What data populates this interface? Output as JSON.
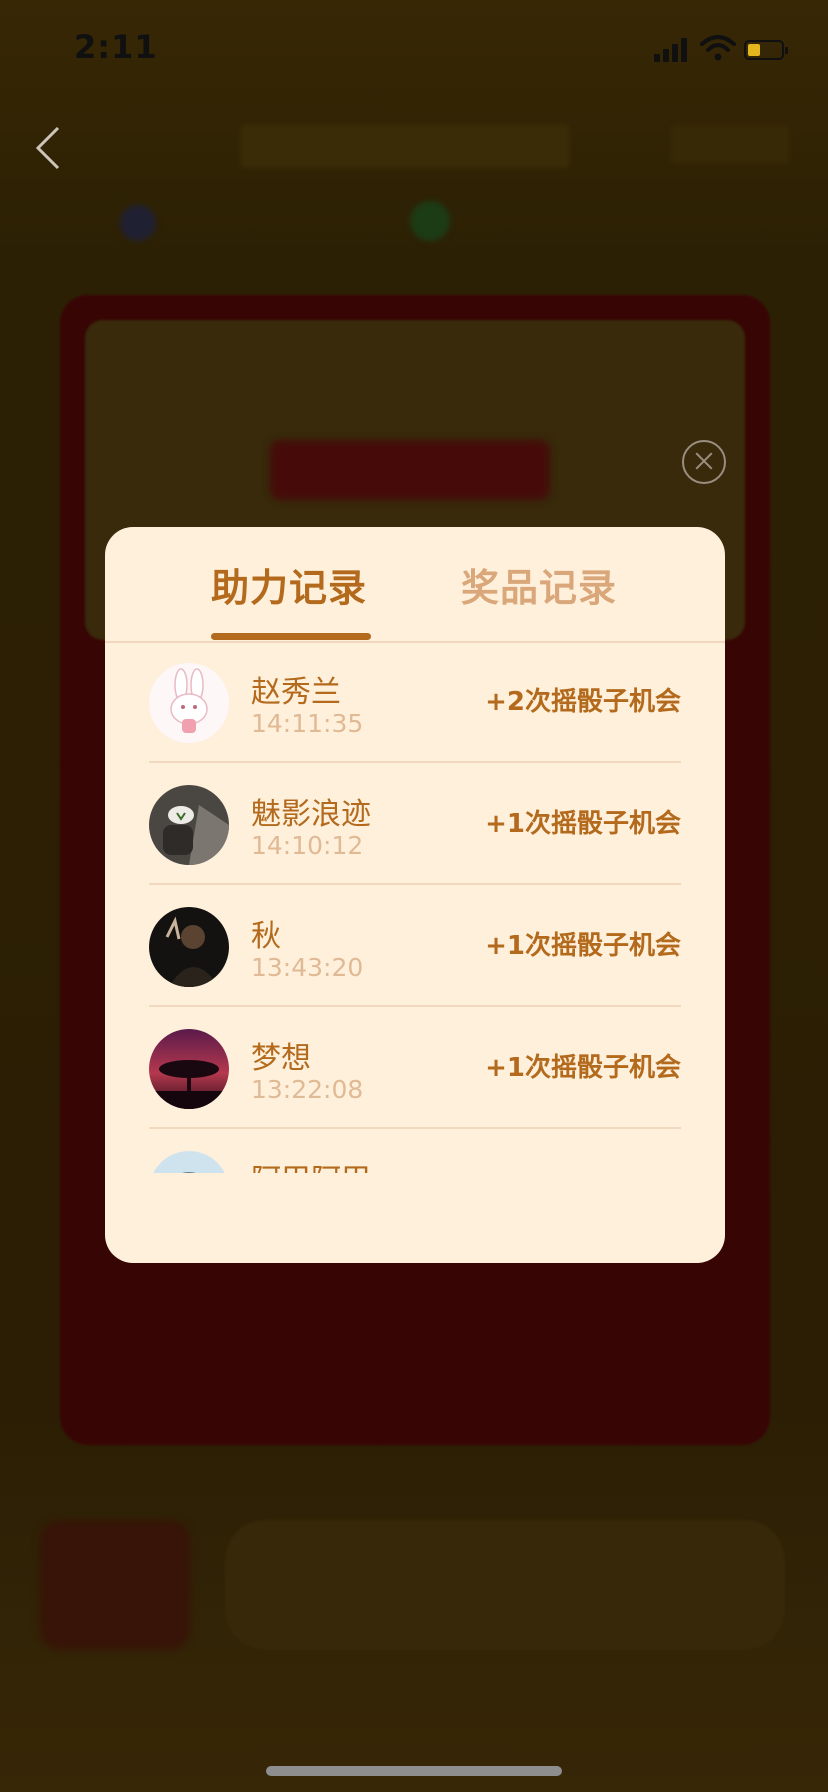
{
  "status_bar": {
    "time": "2:11"
  },
  "modal": {
    "tabs": [
      {
        "label": "助力记录",
        "active": true
      },
      {
        "label": "奖品记录",
        "active": false
      }
    ],
    "records": [
      {
        "name": "赵秀兰",
        "time": "14:11:35",
        "reward": "+2次摇骰子机会",
        "avatar": "rabbit-avatar"
      },
      {
        "name": "魅影浪迹",
        "time": "14:10:12",
        "reward": "+1次摇骰子机会",
        "avatar": "cup-avatar"
      },
      {
        "name": "秋",
        "time": "13:43:20",
        "reward": "+1次摇骰子机会",
        "avatar": "person-avatar"
      },
      {
        "name": "梦想",
        "time": "13:22:08",
        "reward": "+1次摇骰子机会",
        "avatar": "sunset-tree-avatar"
      },
      {
        "name": "阿甲阿甲",
        "time": "",
        "reward": "",
        "avatar": "cartoon-avatar"
      }
    ]
  },
  "colors": {
    "accent": "#b36a1c",
    "accent_light": "#d9a77a",
    "modal_bg": "#fff0dc",
    "time_text": "#e0b995"
  }
}
